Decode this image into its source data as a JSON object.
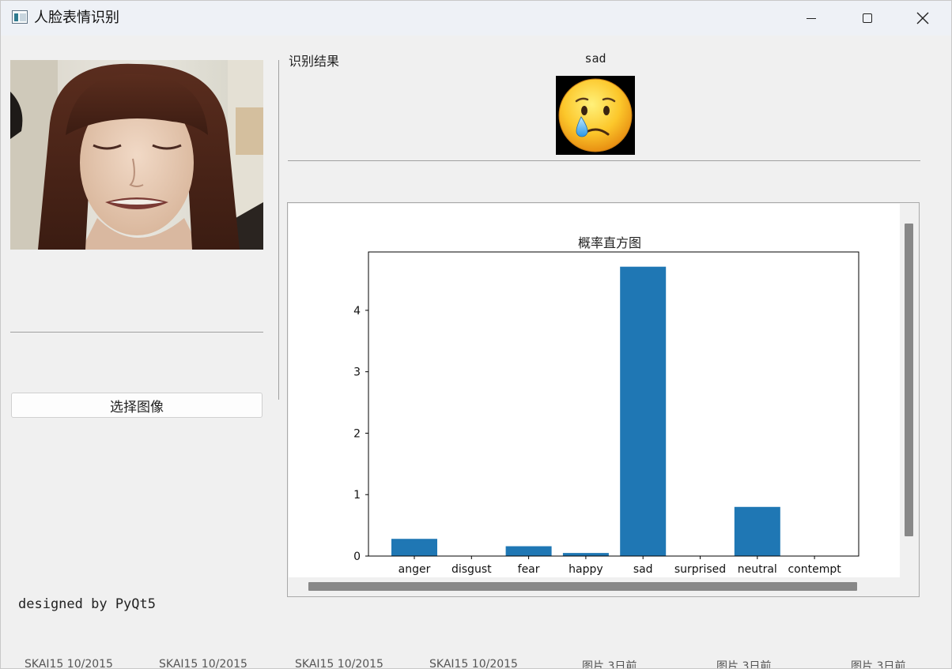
{
  "window": {
    "title": "人脸表情识别"
  },
  "left_panel": {
    "select_button_label": "选择图像",
    "credit_text": "designed by PyQt5"
  },
  "result": {
    "label": "识别结果",
    "emotion": "sad",
    "emoji_icon": "crying-face-icon"
  },
  "colors": {
    "bar": "#1f77b4",
    "scrollbar": "#888888",
    "titlebar": "#eef1f6"
  },
  "chart_data": {
    "type": "bar",
    "title": "概率直方图",
    "categories": [
      "anger",
      "disgust",
      "fear",
      "happy",
      "sad",
      "surprised",
      "neutral",
      "contempt"
    ],
    "values": [
      0.28,
      0.0,
      0.16,
      0.05,
      4.71,
      0.0,
      0.8,
      0.0
    ],
    "yticks": [
      0,
      1,
      2,
      3,
      4
    ],
    "ylim": [
      0,
      4.95
    ],
    "xlabel": "",
    "ylabel": "",
    "grid": false
  },
  "background_fragments": [
    "SKAI15 10/2015",
    "SKAI15 10/2015",
    "SKAI15 10/2015",
    "SKAI15 10/2015",
    "图片 3日前",
    "图片 3日前",
    "图片 3日前"
  ]
}
